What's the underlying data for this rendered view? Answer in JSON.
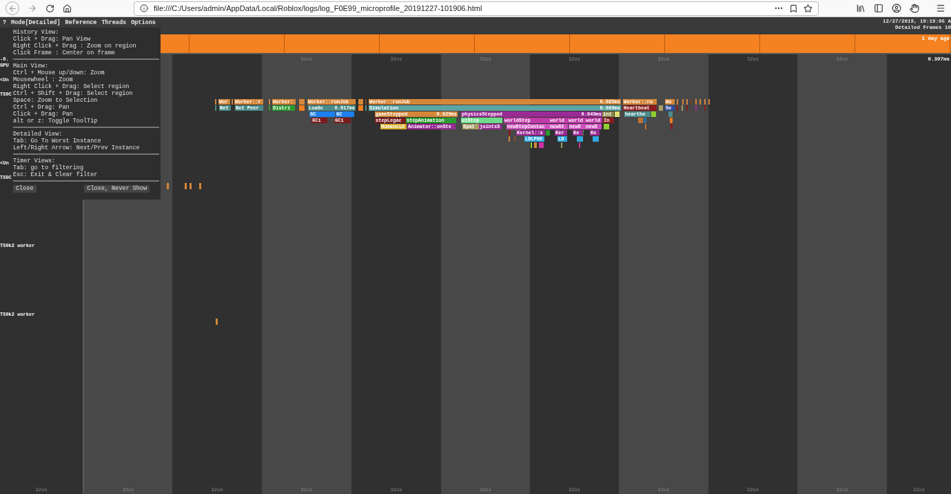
{
  "browser": {
    "url": "file:///C:/Users/admin/AppData/Local/Roblox/logs/log_F0E99_microprofile_20191227-101906.html"
  },
  "menu": [
    {
      "label": "?"
    },
    {
      "label": "Mode[Detailed]"
    },
    {
      "label": "Reference"
    },
    {
      "label": "Threads"
    },
    {
      "label": "Options"
    }
  ],
  "header": {
    "timestamp": "12/27/2019, 10:19:06 A",
    "frames": "Detailed Frames 10"
  },
  "history": {
    "ago": "1 day ago"
  },
  "timeline": {
    "top_ticks": [
      "32us",
      "32us",
      "32us",
      "32us",
      "32us",
      "32us",
      "32us"
    ],
    "top_right": "0.307ms",
    "bottom_ticks": [
      "32us",
      "32us",
      "32us",
      "32us",
      "32us",
      "32us",
      "32us",
      "32us",
      "32us",
      "32us",
      "32us"
    ],
    "tracks": [
      {
        "label": "-0."
      },
      {
        "label": "GPU"
      },
      {
        "label": "<Un"
      },
      {
        "label": "TS0C"
      },
      {
        "label": "<Un"
      },
      {
        "label": "TS0C"
      },
      {
        "label": "TS0k2 worker"
      },
      {
        "label": "TS0k2 worker"
      }
    ],
    "timers": [
      {
        "label": "Wor",
        "color": "#d4873a"
      },
      {
        "label": "Worker::r",
        "color": "#d4873a"
      },
      {
        "label": "Worker:",
        "color": "#d4873a"
      },
      {
        "label": "Worker::runJob",
        "color": "#d4873a"
      },
      {
        "label": "Worker::runJob",
        "timing": "0.089ms",
        "color": "#d4873a"
      },
      {
        "label": "Worker::ru",
        "color": "#d4873a"
      },
      {
        "label": "Wo",
        "color": "#d4873a"
      },
      {
        "label": "Net",
        "color": "#4a8c8a"
      },
      {
        "label": "Net Peer",
        "color": "#4a8c8a"
      },
      {
        "label": "Distri",
        "color": "#2c9a30"
      },
      {
        "label": "LuaGc",
        "timing": "0.017ms",
        "color": "#4a8c8a"
      },
      {
        "label": "Simulation",
        "timing": "0.089ms",
        "color": "#5ba5a3"
      },
      {
        "label": "Heartbeat",
        "color": "#8a1c1c"
      },
      {
        "label": "Se",
        "color": "#2e4c9c"
      },
      {
        "label": "GC",
        "color": "#1e7ff0"
      },
      {
        "label": "GC",
        "color": "#1e7ff0"
      },
      {
        "label": "gameStepped",
        "timing": "0.029ms",
        "color": "#d4873a"
      },
      {
        "label": "physicsStepped",
        "timing": "0.049ms",
        "color": "#9a2a94"
      },
      {
        "label": "int",
        "color": "#8f8a50"
      },
      {
        "label": "hearthe",
        "color": "#4a8c8a"
      },
      {
        "label": "GCi",
        "color": "#7a1a1a"
      },
      {
        "label": "GCi",
        "color": "#7a1a1a"
      },
      {
        "label": "stepLegac",
        "color": "#7a1a1a"
      },
      {
        "label": "stepAnimation",
        "color": "#2c9a30"
      },
      {
        "label": "uiStep",
        "color": "#6edc8c"
      },
      {
        "label": "worldStep",
        "color": "#c23aaa"
      },
      {
        "label": "world",
        "color": "#c23aaa"
      },
      {
        "label": "world",
        "color": "#c23aaa"
      },
      {
        "label": "world",
        "color": "#c23aaa"
      },
      {
        "label": "In",
        "color": "#8a1c1c"
      },
      {
        "label": "Humanoid",
        "color": "#d8b030"
      },
      {
        "label": "Animator::onSte",
        "color": "#9a2a94"
      },
      {
        "label": "Spat",
        "color": "#a8a066"
      },
      {
        "label": "jointsS",
        "color": "#9a2a94"
      },
      {
        "label": "newStepContac",
        "color": "#d050c0"
      },
      {
        "label": "newSt",
        "color": "#d050c0"
      },
      {
        "label": "newS",
        "color": "#d050c0"
      },
      {
        "label": "newS",
        "color": "#d050c0"
      },
      {
        "label": "Kernel::s",
        "color": "#9a2a94"
      },
      {
        "label": "Ker",
        "color": "#9a2a94"
      },
      {
        "label": "Ke",
        "color": "#9a2a94"
      },
      {
        "label": "Ke",
        "color": "#9a2a94"
      },
      {
        "label": "LDLPGS",
        "color": "#30a8e0"
      },
      {
        "label": "LD",
        "color": "#30a8e0"
      }
    ]
  },
  "help": {
    "sections": [
      {
        "title": "History View:",
        "lines": [
          "Click + Drag: Pan View",
          "Right Click + Drag : Zoom on region",
          "Click Frame : Center on frame"
        ]
      },
      {
        "title": "Main View:",
        "lines": [
          "Ctrl + Mouse up/down: Zoom",
          "Mousewheel : Zoom",
          "Right Click + Drag: Select region",
          "Ctrl + Shift + Drag: Select region",
          "Space: Zoom to Selection",
          "Ctrl + Drag: Pan",
          "Click + Drag: Pan",
          "alt or z: Toggle ToolTip"
        ]
      },
      {
        "title": "Detailed View:",
        "lines": [
          "Tab: Go To Worst Instance",
          "Left/Right Arrow: Next/Prev Instance"
        ]
      },
      {
        "title": "Timer Views:",
        "lines": [
          "Tab: go to filtering",
          "Esc: Exit & Clear filter"
        ]
      }
    ],
    "buttons": [
      {
        "label": "Close"
      },
      {
        "label": "Close, Never Show"
      }
    ]
  }
}
